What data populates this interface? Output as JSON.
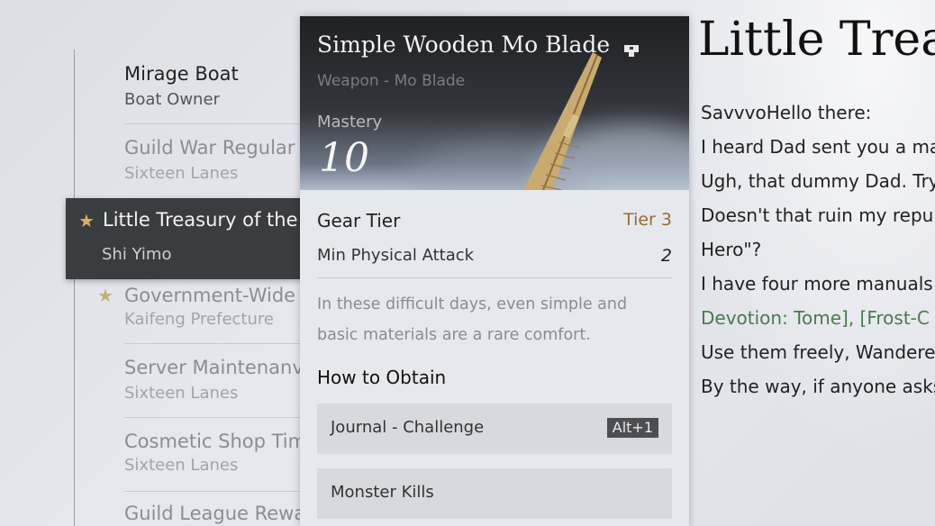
{
  "mail_list": {
    "items": [
      {
        "title": "Mirage Boat",
        "sender": "Boat Owner",
        "state": "unread",
        "starred": false
      },
      {
        "title": "Guild War Regular",
        "sender": "Sixteen Lanes",
        "state": "read",
        "starred": false
      },
      {
        "title": "Little Treasury of the",
        "sender": "Shi Yimo",
        "state": "selected",
        "starred": true
      },
      {
        "title": "Government-Wide",
        "sender": "Kaifeng Prefecture",
        "state": "read",
        "starred": true
      },
      {
        "title": "Server Maintenanv",
        "sender": "Sixteen Lanes",
        "state": "read",
        "starred": false
      },
      {
        "title": "Cosmetic Shop Tim",
        "sender": "Sixteen Lanes",
        "state": "read",
        "starred": false
      },
      {
        "title": "Guild League Rewa",
        "sender": "",
        "state": "read",
        "starred": false
      }
    ]
  },
  "mail": {
    "heading": "Little Treas",
    "lines": [
      {
        "text": "SavvvoHello there:",
        "style": "normal"
      },
      {
        "text": "I heard Dad sent you a ma",
        "style": "normal"
      },
      {
        "text": "Ugh, that dummy Dad. Try",
        "style": "normal"
      },
      {
        "text": "Doesn't that ruin my repu",
        "style": "normal"
      },
      {
        "text": "Hero\"?",
        "style": "normal"
      },
      {
        "text": "I have four more manuals",
        "style": "normal"
      },
      {
        "text": "Devotion: Tome], [Frost-C",
        "style": "green"
      },
      {
        "text": "Use them freely, Wandere",
        "style": "normal"
      },
      {
        "text": "By the way, if anyone asks",
        "style": "normal"
      }
    ]
  },
  "item_card": {
    "name": "Simple Wooden Mo Blade",
    "type": "Weapon - Mo Blade",
    "mastery_label": "Mastery",
    "mastery_value": "10",
    "gear_tier_label": "Gear Tier",
    "gear_tier_value": "Tier 3",
    "min_attack_label": "Min Physical Attack",
    "min_attack_value": "2",
    "description": "In these difficult days, even simple and basic materials are a rare comfort.",
    "obtain_title": "How to Obtain",
    "sources": [
      {
        "label": "Journal - Challenge",
        "hotkey": "Alt+1"
      },
      {
        "label": "Monster Kills",
        "hotkey": ""
      }
    ],
    "colors": {
      "tier": "#9a6a2e",
      "green_text": "#4b7a4f",
      "star": "#d8b15e"
    }
  }
}
